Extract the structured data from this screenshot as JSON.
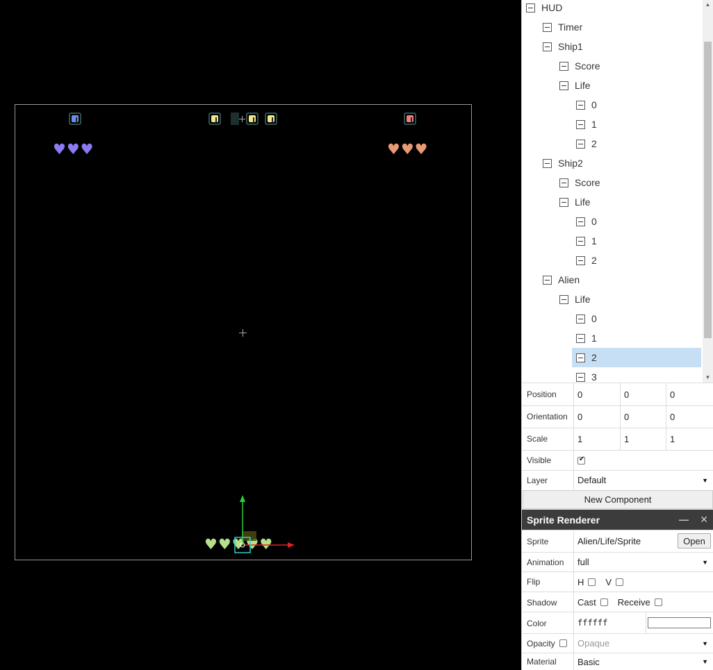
{
  "hud": {
    "ship1_digit_color": "#6b8ff0",
    "timer_digit_color": "#f0e68c",
    "ship2_digit_color": "#f08080",
    "timer_separator": ":",
    "ship1_hearts": [
      "♥",
      "♥",
      "♥"
    ],
    "ship1_heart_color": "#8a7cf0",
    "ship2_hearts": [
      "♥",
      "♥",
      "♥"
    ],
    "ship2_heart_color": "#e99a74",
    "alien_hearts": [
      "♥",
      "♥",
      "♥",
      "♥",
      "♥"
    ],
    "alien_heart_color": "#b7e08a"
  },
  "tree": {
    "items": [
      {
        "label": "HUD"
      },
      {
        "label": "Timer"
      },
      {
        "label": "Ship1"
      },
      {
        "label": "Score"
      },
      {
        "label": "Life"
      },
      {
        "label": "0"
      },
      {
        "label": "1"
      },
      {
        "label": "2"
      },
      {
        "label": "Ship2"
      },
      {
        "label": "Score"
      },
      {
        "label": "Life"
      },
      {
        "label": "0"
      },
      {
        "label": "1"
      },
      {
        "label": "2"
      },
      {
        "label": "Alien"
      },
      {
        "label": "Life"
      },
      {
        "label": "0"
      },
      {
        "label": "1"
      },
      {
        "label": "2"
      },
      {
        "label": "3"
      }
    ],
    "selected_index": 18
  },
  "transform": {
    "position_label": "Position",
    "position": [
      "0",
      "0",
      "0"
    ],
    "orientation_label": "Orientation",
    "orientation": [
      "0",
      "0",
      "0"
    ],
    "scale_label": "Scale",
    "scale": [
      "1",
      "1",
      "1"
    ],
    "visible_label": "Visible",
    "visible_checked": true,
    "layer_label": "Layer",
    "layer_value": "Default"
  },
  "new_component_label": "New Component",
  "component": {
    "title": "Sprite Renderer",
    "minimize": "—",
    "close": "✕",
    "sprite_label": "Sprite",
    "sprite_value": "Alien/Life/Sprite",
    "open_label": "Open",
    "animation_label": "Animation",
    "animation_value": "full",
    "flip_label": "Flip",
    "flip_h": "H",
    "flip_v": "V",
    "shadow_label": "Shadow",
    "cast_label": "Cast",
    "receive_label": "Receive",
    "color_label": "Color",
    "color_value": "ffffff",
    "opacity_label": "Opacity",
    "opacity_value": "Opaque",
    "material_label": "Material",
    "material_value": "Basic"
  },
  "dropdown_arrow": "▼"
}
